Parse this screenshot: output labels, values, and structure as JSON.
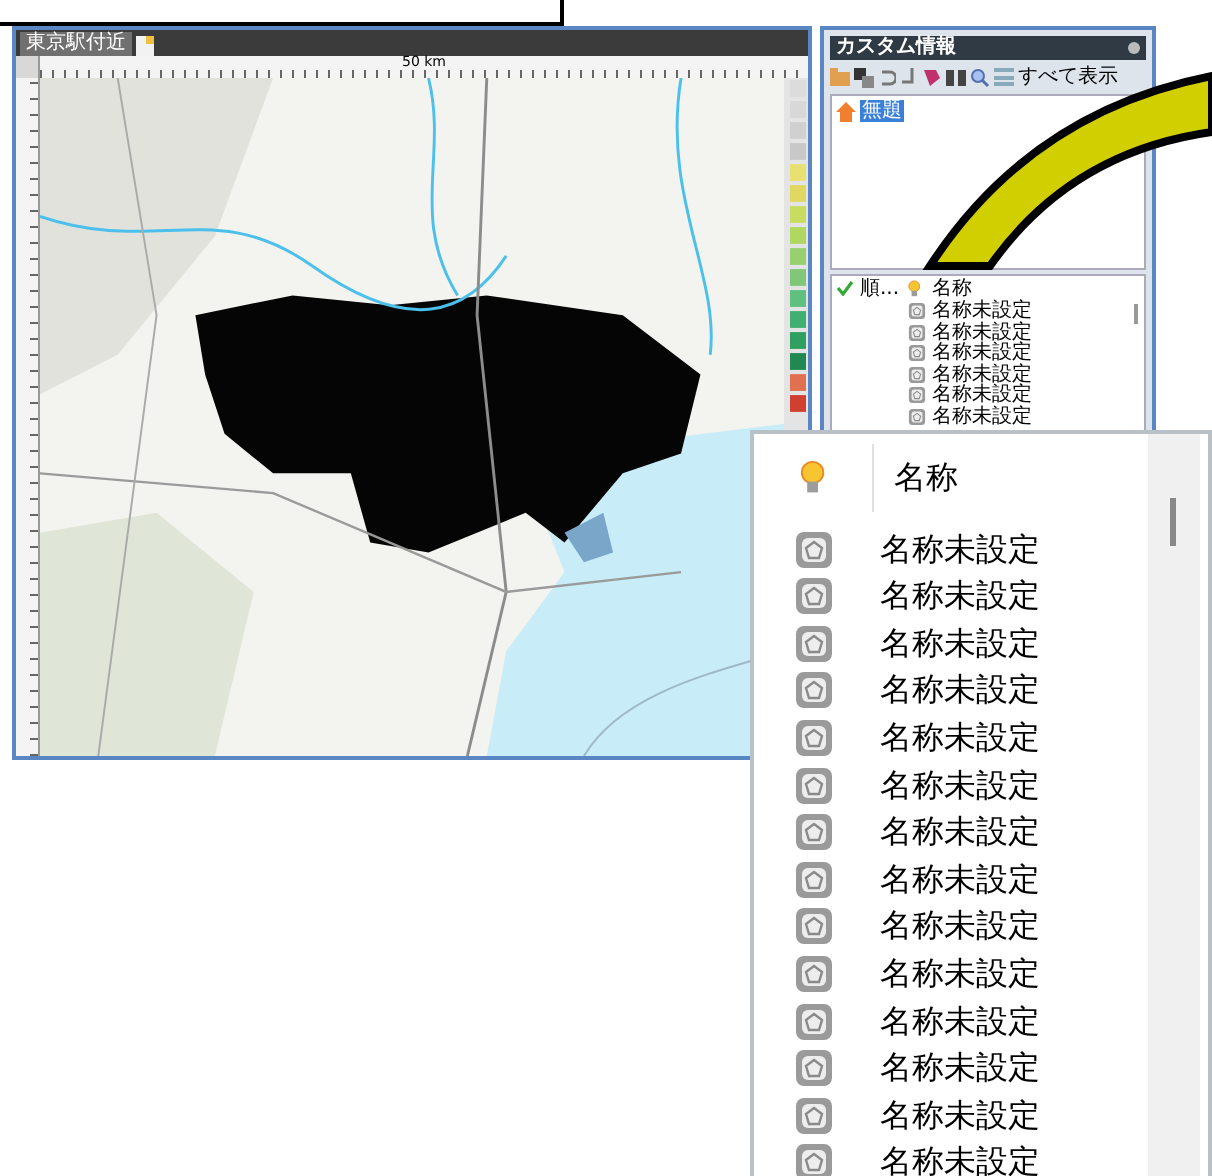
{
  "map_window": {
    "tab": "東京駅付近",
    "scale_label": "50 km"
  },
  "custom_panel": {
    "title": "カスタム情報",
    "show_all": "すべて表示",
    "tree": [
      {
        "label": "無題",
        "selected": true
      }
    ],
    "list": {
      "columns": [
        "順...",
        "名称"
      ],
      "rows": [
        "名称未設定",
        "名称未設定",
        "名称未設定",
        "名称未設定",
        "名称未設定",
        "名称未設定"
      ]
    }
  },
  "callout": {
    "header": "名称",
    "rows": [
      "名称未設定",
      "名称未設定",
      "名称未設定",
      "名称未設定",
      "名称未設定",
      "名称未設定",
      "名称未設定",
      "名称未設定",
      "名称未設定",
      "名称未設定",
      "名称未設定",
      "名称未設定",
      "名称未設定",
      "名称未設定"
    ]
  }
}
